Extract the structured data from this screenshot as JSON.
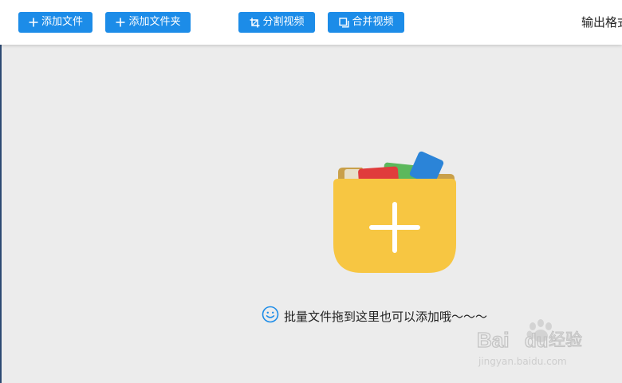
{
  "toolbar": {
    "add_file_label": "添加文件",
    "add_folder_label": "添加文件夹",
    "split_video_label": "分割视频",
    "merge_video_label": "合并视频",
    "output_format_label": "输出格式"
  },
  "drop_zone": {
    "hint_text": "批量文件拖到这里也可以添加哦～～～",
    "icon": "folder-add-icon"
  },
  "watermark": {
    "brand": "Baidu经验",
    "url": "jingyan.baidu.com"
  },
  "colors": {
    "accent": "#1c8ce8",
    "folder_yellow": "#f7c642",
    "background": "#ececec"
  }
}
